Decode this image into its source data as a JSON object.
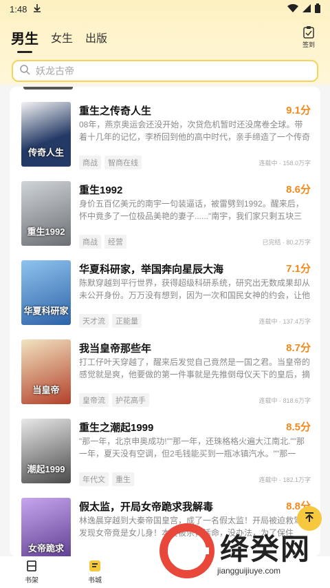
{
  "status": {
    "time": "1:48"
  },
  "tabs": [
    {
      "label": "男生"
    },
    {
      "label": "女生"
    },
    {
      "label": "出版"
    }
  ],
  "checkin_label": "签到",
  "search": {
    "placeholder": "妖龙古帝"
  },
  "books": [
    {
      "title": "重生之传奇人生",
      "score": "9.1分",
      "desc": "08年，燕京奥运会还没开始，次贷危机暂时还没席卷全球。带着十几年的记忆，李桥回到他的高中时代，亲手缔造了一个传奇人生。",
      "tags": [
        "商战",
        "智商在线"
      ],
      "meta": "连载中 · 158.0万字",
      "cover_text": "传奇人生",
      "cover_color": "#243a66"
    },
    {
      "title": "重生1992",
      "score": "8.6分",
      "desc": "身价五百亿美元的南宇一句装逼话，被雷劈到1992。醒来后，怀中竟多了一位极品美艳的妻子......\"南宇，我们家只剩五块三角钱了......\"",
      "tags": [
        "商战",
        "经营"
      ],
      "meta": "已完结 · 80.2万字",
      "cover_text": "重生1992",
      "cover_color": "#6b6f73"
    },
    {
      "title": "华夏科研家，举国奔向星辰大海",
      "score": "7.1分",
      "desc": "陈默穿越到平行世界，获得超级科研系统，研究出无数成果却从未公开身份。万万没有想到，因为一次和国民女神的约会，让他的身份曝光了。全息影像！空天飞机！量子计算机！可控核聚变！星系穿梭器......原...",
      "tags": [
        "天才流",
        "正能量"
      ],
      "meta": "连载中 · 137.4万字",
      "cover_text": "华夏科研家",
      "cover_color": "#2d63a8"
    },
    {
      "title": "我当皇帝那些年",
      "score": "8.7分",
      "desc": "打工仔叶天穿越了，醒来后发觉自己竟然是一国之君。当皇帝的感觉就是爽，他要做的第一件事就是先推倒母仪天下的皇后，摘掉童子鸡的帽子，然后再酒池肉林，大开无遮大会。爱江山，更爱美人，天下美女...",
      "tags": [
        "皇帝流",
        "护花高手"
      ],
      "meta": "连载中 · 818.6万字",
      "cover_text": "当皇帝",
      "cover_color": "#b3402a"
    },
    {
      "title": "重生之潮起1999",
      "score": "8.5分",
      "desc": "\"那一年，北京申奥成功!\"\"那一年，还珠格格火遍大江南北.\"\"那一年，夏天没有空调，但2毛钱能买到一瓶冰镇汽水。\"\"那一年，我最混蛋的年纪，却遇上了最想照顾的两个人。\"\"我多想回到那一年。\"......商海巨鳄...",
      "tags": [
        "年代文",
        "重生"
      ],
      "meta": "连载中 · 182.1万字",
      "cover_text": "潮起1999",
      "cover_color": "#4a4a4a"
    },
    {
      "title": "假太监，开局女帝跪求我解毒",
      "score": "8.8分",
      "desc": "林逸晨穿越到大秦帝国皇宫，成了一名假太监！开局被迫救驾，发现女帝竟是女儿身！本要被杀，活命，没办法，为了保住",
      "tags": [],
      "meta": "",
      "cover_text": "女帝跪求",
      "cover_color": "#5a3a8c"
    }
  ],
  "nav": [
    {
      "label": "书架"
    },
    {
      "label": "书城"
    }
  ],
  "watermark": {
    "text": "绛癸网",
    "url": "jiangguijiuye.com"
  },
  "colors": {
    "accent": "#f08a1c",
    "search_border": "#f6d35a"
  }
}
